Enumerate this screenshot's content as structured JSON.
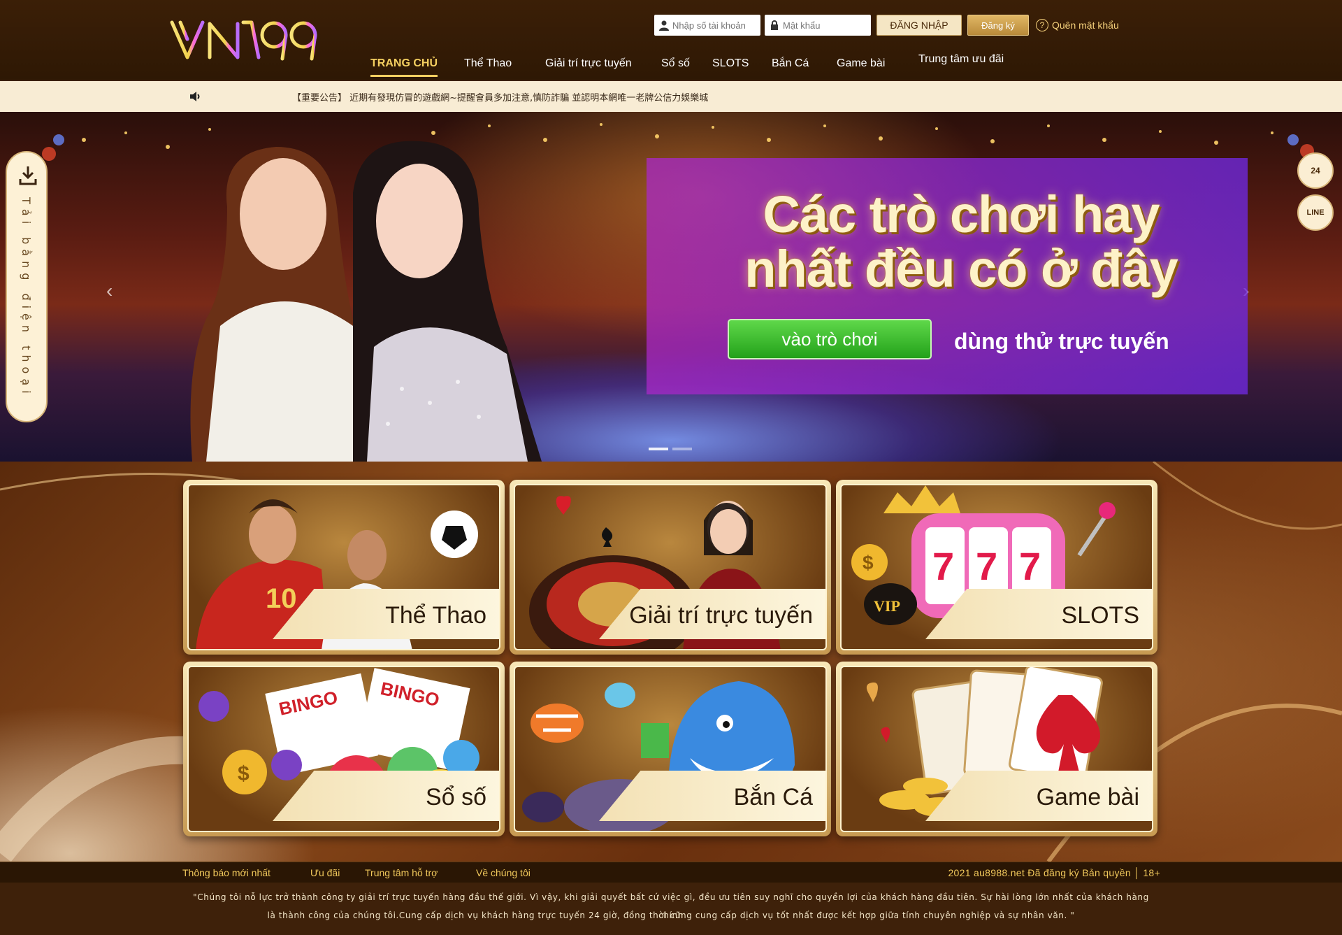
{
  "brand": {
    "logo_text": "VN99"
  },
  "header": {
    "username_placeholder": "Nhập số tài khoản",
    "password_placeholder": "Mật khẩu",
    "login_label": "ĐĂNG NHẬP",
    "register_label": "Đăng ký",
    "forgot_label": "Quên mật khẩu"
  },
  "nav": {
    "items": [
      {
        "label": "TRANG CHỦ",
        "active": true
      },
      {
        "label": "Thể Thao"
      },
      {
        "label": "Giải trí trực tuyến"
      },
      {
        "label": "Sổ số"
      },
      {
        "label": "SLOTS"
      },
      {
        "label": "Bắn Cá"
      },
      {
        "label": "Game bài"
      },
      {
        "label": "Trung tâm ưu đãi"
      }
    ]
  },
  "notice": {
    "text": "【重要公告】 近期有發現仿冒的遊戲網~提醒會員多加注意,慎防詐騙 並認明本網唯一老牌公信力娛樂城"
  },
  "banner": {
    "title_line1": "Các trò chơi hay",
    "title_line2": "nhất đều có ở đây",
    "enter_label": "vào trò chơi",
    "try_label": "dùng thử trực tuyến"
  },
  "side": {
    "download_label": "Tải bằng điện thoại",
    "support_label": "24",
    "line_label": "LINE"
  },
  "games": [
    {
      "label": "Thể Thao",
      "icon": "sports-icon"
    },
    {
      "label": "Giải trí trực tuyến",
      "icon": "live-casino-icon"
    },
    {
      "label": "SLOTS",
      "icon": "slots-icon"
    },
    {
      "label": "Sổ số",
      "icon": "lottery-icon"
    },
    {
      "label": "Bắn Cá",
      "icon": "fishing-icon"
    },
    {
      "label": "Game bài",
      "icon": "card-game-icon"
    }
  ],
  "footer": {
    "links": [
      "Thông báo mới nhất",
      "Ưu đãi",
      "Trung tâm hỗ trợ",
      "Về chúng tôi"
    ],
    "copyright": "2021 au8988.net Đã đăng ký Bản quyền │ 18+",
    "line1": "\"Chúng tôi nỗ lực trở thành công ty giải trí trực tuyến hàng đầu thế giới. Vì vậy, khi giải quyết bất cứ việc gì, đều ưu tiên suy nghĩ cho quyền lợi của khách hàng đầu tiên. Sự hài lòng lớn nhất của khách hàng chính",
    "line2": "là thành công của chúng tôi.Cung cấp dịch vụ khách hàng trực tuyến 24 giờ, đồng thời cũng cung cấp dịch vụ tốt nhất được kết hợp giữa tính chuyên nghiệp và sự nhân văn. \""
  },
  "colors": {
    "accent": "#f5d061",
    "header_bg": "#2e1804",
    "notice_bg": "#f8ecd4",
    "cta_green": "#23a11a"
  }
}
